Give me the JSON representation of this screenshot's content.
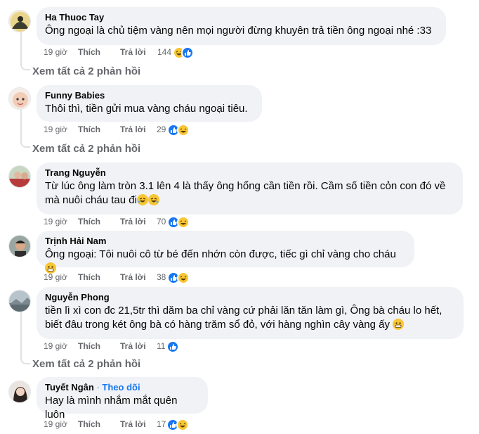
{
  "labels": {
    "like": "Thích",
    "reply": "Trả lời",
    "see_more": "Xem tất cả 2 phản hồi",
    "follow": "Theo dõi",
    "follow_dot": "·"
  },
  "comments": [
    {
      "author": "Ha Thuoc Tay",
      "text": "Ông ngoại là chủ tiệm vàng nên mọi người đừng khuyên trả tiền ông ngoại nhé :33",
      "time": "19 giờ",
      "count": "144",
      "reactions": [
        "haha-icon",
        "like-icon"
      ],
      "see_more": true
    },
    {
      "author": "Funny Babies",
      "text": "Thôi thì, tiền gửi mua vàng cháu ngoại tiêu.",
      "time": "19 giờ",
      "count": "29",
      "reactions": [
        "like-icon",
        "haha-icon"
      ],
      "see_more": true
    },
    {
      "author": "Trang Nguyễn",
      "text_line1": "Từ lúc ông làm tròn 3.1 lên 4 là thấy ông hổng cần tiền rồi. Cầm số tiền cỏn con đó về",
      "text_line2": "mà nuôi cháu tau đi",
      "time": "19 giờ",
      "count": "70",
      "reactions": [
        "like-icon",
        "haha-icon"
      ],
      "see_more": false
    },
    {
      "author": "Trịnh Hải Nam",
      "text": "Ông ngoại: Tôi nuôi cô từ bé đến nhớn còn được, tiếc gì chỉ vàng cho cháu",
      "time": "19 giờ",
      "count": "38",
      "reactions": [
        "like-icon",
        "haha-icon"
      ],
      "see_more": false
    },
    {
      "author": "Nguyễn Phong",
      "text_line1": "tiền lì xì con đc 21,5tr thì dăm ba chỉ vàng cứ phải lăn tăn làm gì, Ông bà cháu lo hết,",
      "text_line2": "biết đâu trong két ông bà có hàng trăm sổ đỏ, với hàng nghìn cây vàng ấy",
      "time": "19 giờ",
      "count": "11",
      "reactions": [
        "like-icon"
      ],
      "see_more": true
    },
    {
      "author": "Tuyết Ngân",
      "text": "Hay là mình nhắm mắt quên luôn",
      "time": "19 giờ",
      "count": "17",
      "reactions": [
        "like-icon",
        "haha-icon"
      ],
      "see_more": false,
      "follow": true
    }
  ]
}
